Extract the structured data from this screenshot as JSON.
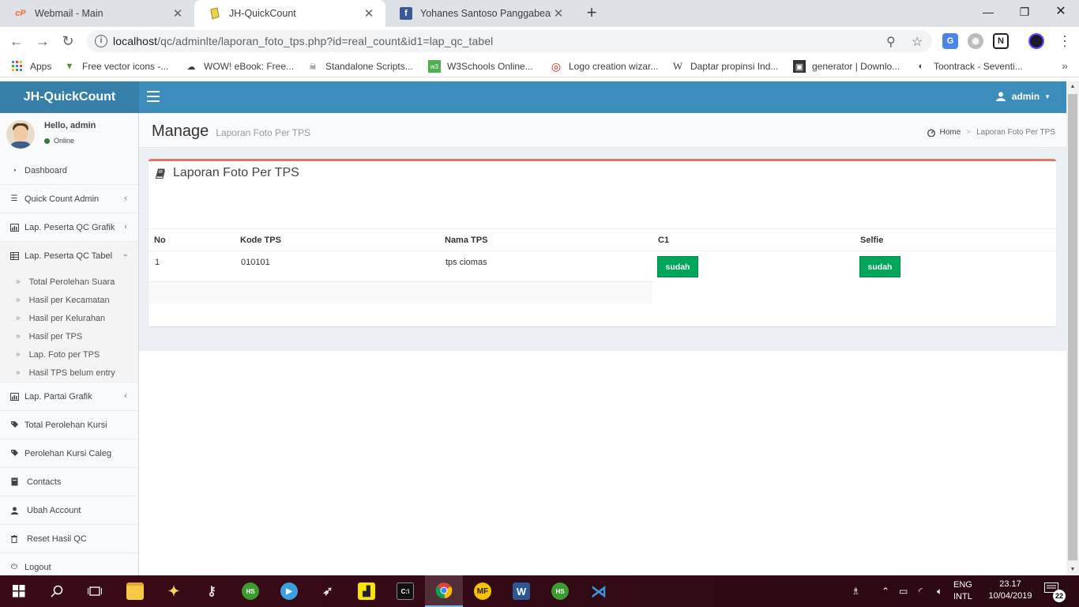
{
  "browser": {
    "tabs": [
      {
        "title": "Webmail - Main",
        "icon": "cpanel-icon"
      },
      {
        "title": "JH-QuickCount",
        "icon": "page-icon"
      },
      {
        "title": "Yohanes Santoso Panggabean",
        "icon": "facebook-icon"
      }
    ],
    "url_host": "localhost",
    "url_path": "/qc/adminlte/laporan_foto_tps.php?id=real_count&id1=lap_qc_tabel",
    "bookmarks": [
      {
        "label": "Apps"
      },
      {
        "label": "Free vector icons -..."
      },
      {
        "label": "WOW! eBook: Free..."
      },
      {
        "label": "Standalone Scripts..."
      },
      {
        "label": "W3Schools Online..."
      },
      {
        "label": "Logo creation wizar..."
      },
      {
        "label": "Daptar propinsi Ind..."
      },
      {
        "label": "generator | Downlo..."
      },
      {
        "label": "Toontrack - Seventi..."
      }
    ]
  },
  "app": {
    "logo": "JH-QuickCount",
    "user_menu": "admin",
    "user_panel": {
      "hello": "Hello, admin",
      "status": "Online"
    },
    "sidebar": {
      "items": [
        {
          "label": "Dashboard"
        },
        {
          "label": "Quick Count Admin"
        },
        {
          "label": "Lap. Peserta QC Grafik"
        },
        {
          "label": "Lap. Peserta QC Tabel"
        },
        {
          "label": "Lap. Partai Grafik"
        },
        {
          "label": "Total Perolehan Kursi"
        },
        {
          "label": "Perolehan Kursi Caleg"
        },
        {
          "label": "Contacts"
        },
        {
          "label": "Ubah Account"
        },
        {
          "label": "Reset Hasil QC"
        },
        {
          "label": "Logout"
        }
      ],
      "submenu": [
        {
          "label": "Total Perolehan Suara"
        },
        {
          "label": "Hasil per Kecamatan"
        },
        {
          "label": "Hasil per Kelurahan"
        },
        {
          "label": "Hasil per TPS"
        },
        {
          "label": "Lap. Foto per TPS"
        },
        {
          "label": "Hasil TPS belum entry"
        }
      ]
    },
    "content": {
      "title": "Manage",
      "subtitle": "Laporan Foto Per TPS",
      "breadcrumb": {
        "home": "Home",
        "current": "Laporan Foto Per TPS"
      },
      "box_title": "Laporan Foto Per TPS",
      "table": {
        "headers": [
          "No",
          "Kode TPS",
          "Nama TPS",
          "C1",
          "Selfie"
        ],
        "rows": [
          {
            "no": "1",
            "kode": "010101",
            "nama": "tps ciomas",
            "c1": "sudah",
            "selfie": "sudah"
          }
        ]
      }
    }
  },
  "taskbar": {
    "lang_top": "ENG",
    "lang_bottom": "INTL",
    "time": "23.17",
    "date": "10/04/2019",
    "notifications": "22"
  },
  "colors": {
    "header": "#3c8dbc",
    "logo_bg": "#367fa9",
    "box_accent": "#e0786a",
    "button_green": "#00a65a"
  }
}
